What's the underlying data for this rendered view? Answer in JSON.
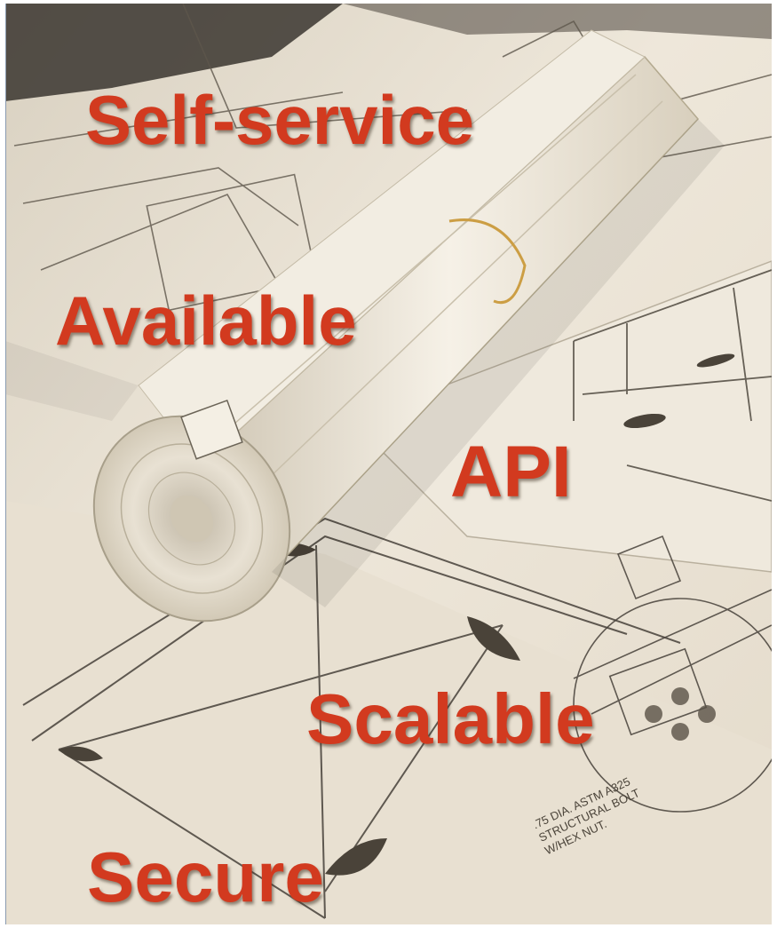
{
  "image": {
    "subject": "rolled architectural blueprints on a table",
    "accent_color": "#d23a1f"
  },
  "overlay_words": [
    "Self-service",
    "Available",
    "API",
    "Scalable",
    "Secure"
  ],
  "blueprint_notes": {
    "line_1": ".75 DIA. ASTM A325",
    "line_2": "STRUCTURAL BOLT",
    "line_3": "W/HEX NUT."
  }
}
